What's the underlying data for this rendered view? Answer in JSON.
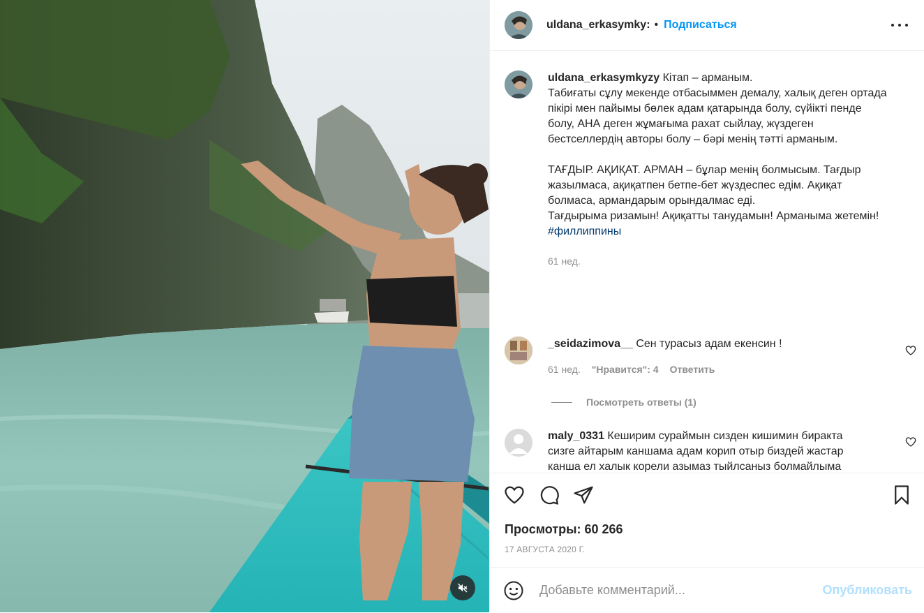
{
  "post": {
    "author": {
      "username_header": "uldana_erkasymky:",
      "separator": "•",
      "follow_label": "Подписаться",
      "more_icon": "more-horizontal-icon"
    },
    "caption": {
      "username": "uldana_erkasymkyzy",
      "title": "Кітап – арманым.",
      "lines": [
        "Табиғаты сұлу мекенде отбасыммен демалу, халық деген ортада",
        "пікірі мен пайымы бөлек адам қатарында болу, сүйікті пенде",
        "болу, АНА деген жұмағыма рахат сыйлау, жүздеген",
        "бестселлердің авторы болу – бәрі менің тәтті арманым."
      ],
      "lines2": [
        "ТАҒДЫР. АҚИҚАТ. АРМАН – бұлар менің болмысым. Тағдыр",
        "жазылмаса, ақиқатпен бетпе-бет жүздеспес едім. Ақиқат",
        "болмаса, армандарым орындалмас еді.",
        "Тағдырыма ризамын! Ақиқатты танудамын! Арманыма жетемін!"
      ],
      "hashtag": "#филлиппины",
      "time": "61 нед."
    },
    "comments": [
      {
        "username": "_seidazimova__",
        "lines": [
          "Сен турасыз адам екенсин !"
        ],
        "time": "61 нед.",
        "likes": "\"Нравится\": 4",
        "reply_label": "Ответить",
        "view_replies": "Посмотреть ответы (1)"
      },
      {
        "username": "maly_0331",
        "lines": [
          "Кеширим сураймын сизден кишимин биракта",
          "сизге айтарым каншама адам корип отыр биздей жастар",
          "канша ел халык корели азымаз тыйлсаныз болмайлыма"
        ]
      }
    ],
    "views": "Просмотры: 60 266",
    "date": "17 АВГУСТА 2020 Г.",
    "add_comment": {
      "placeholder": "Добавьте комментарий...",
      "publish_label": "Опубликовать"
    }
  },
  "colors": {
    "accent": "#0095f6",
    "publish_disabled": "#b2dffc",
    "secondary_text": "#8e8e8e",
    "hashtag": "#00376b"
  }
}
